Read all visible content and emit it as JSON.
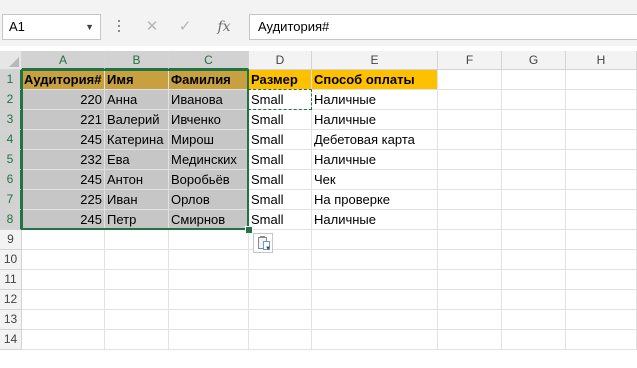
{
  "name_box": {
    "value": "A1"
  },
  "formula_bar": {
    "cancel_icon": "✕",
    "enter_icon": "✓",
    "fx_label": "fx",
    "value": "Аудитория#"
  },
  "columns": [
    "A",
    "B",
    "C",
    "D",
    "E",
    "F",
    "G",
    "H"
  ],
  "rows": [
    "1",
    "2",
    "3",
    "4",
    "5",
    "6",
    "7",
    "8",
    "9",
    "10",
    "11",
    "12",
    "13",
    "14"
  ],
  "table": {
    "headers": [
      "Аудитория#",
      "Имя",
      "Фамилия",
      "Размер",
      "Способ оплаты"
    ],
    "rows": [
      [
        "220",
        "Анна",
        "Иванова",
        "Small",
        "Наличные"
      ],
      [
        "221",
        "Валерий",
        "Ивченко",
        "Small",
        "Наличные"
      ],
      [
        "245",
        "Катерина",
        "Мирош",
        "Small",
        "Дебетовая карта"
      ],
      [
        "232",
        "Ева",
        "Мединских",
        "Small",
        "Наличные"
      ],
      [
        "245",
        "Антон",
        "Воробьёв",
        "Small",
        "Чек"
      ],
      [
        "225",
        "Иван",
        "Орлов",
        "Small",
        "На проверке"
      ],
      [
        "245",
        "Петр",
        "Смирнов",
        "Small",
        "Наличные"
      ]
    ]
  },
  "colors": {
    "header_fill": "#ffc000",
    "selection": "#217346",
    "selected_fill": "#c6c6c6"
  },
  "icons": {
    "paste_options": "paste-options-icon",
    "namebox_dropdown": "chevron-down-icon"
  }
}
